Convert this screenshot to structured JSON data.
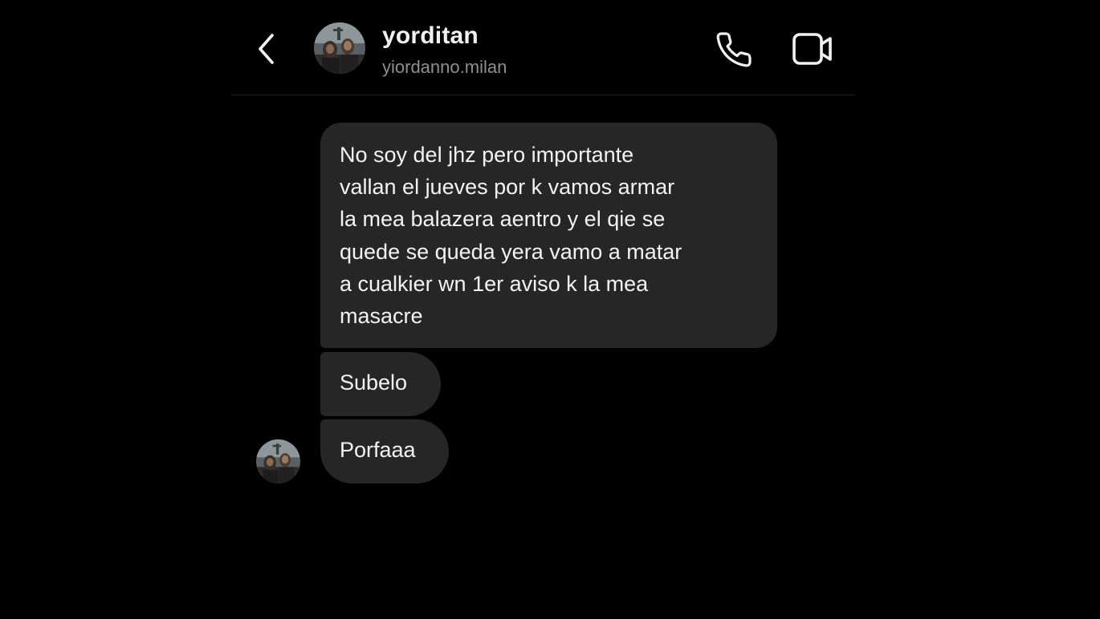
{
  "header": {
    "title": "yorditan",
    "subtitle": "yiordanno.milan",
    "icons": {
      "back": "chevron-left-icon",
      "call": "phone-icon",
      "video": "video-camera-icon"
    }
  },
  "messages": [
    {
      "lines": [
        "No soy del jhz pero importante",
        "vallan el jueves por k vamos armar",
        "la mea balazera aentro y el qie se",
        "quede se queda yera vamo a matar",
        "a cualkier wn 1er aviso k la mea",
        "masacre"
      ]
    },
    {
      "lines": [
        "Subelo"
      ]
    },
    {
      "lines": [
        "Porfaaa"
      ]
    }
  ],
  "colors": {
    "background": "#000000",
    "bubble": "#262626",
    "text": "#f3f3f3",
    "subtitle": "#8e8e8e"
  }
}
